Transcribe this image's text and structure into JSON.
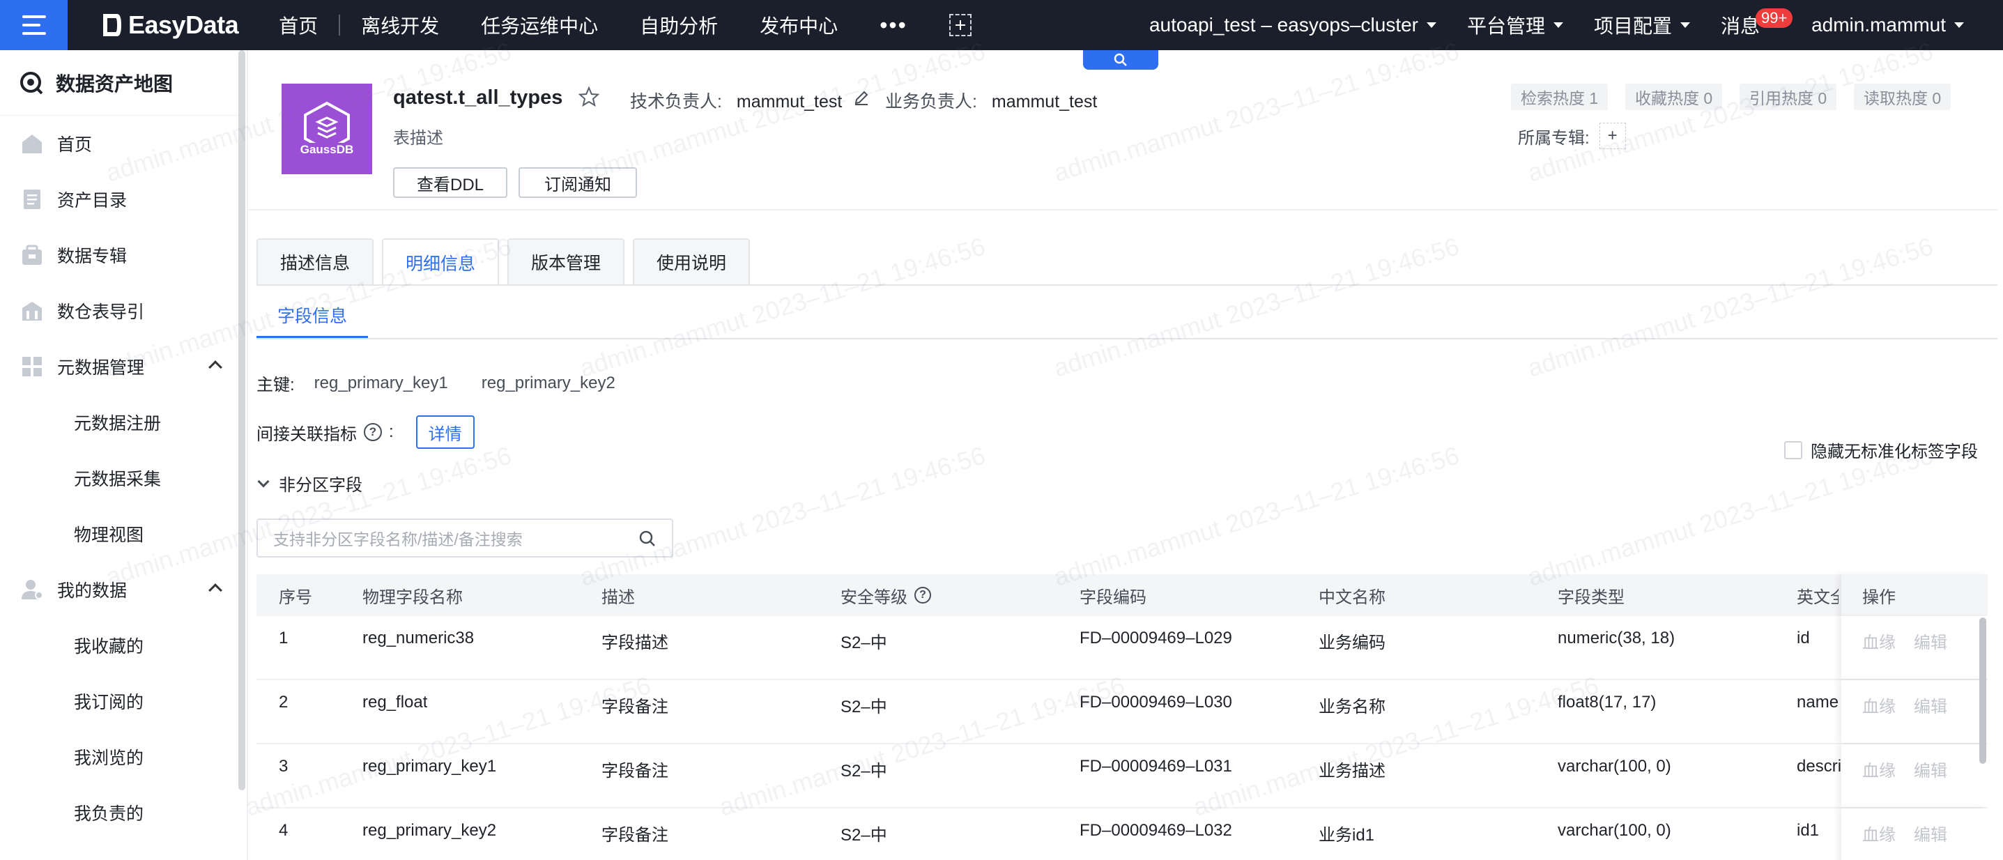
{
  "topnav": {
    "logo": "EasyData",
    "items": [
      "首页",
      "离线开发",
      "任务运维中心",
      "自助分析",
      "发布中心"
    ],
    "more": "•••",
    "cluster": "autoapi_test – easyops–cluster",
    "platform": "平台管理",
    "project": "项目配置",
    "messages": "消息",
    "messages_badge": "99+",
    "user": "admin.mammut"
  },
  "sidebar": {
    "title": "数据资产地图",
    "items": [
      {
        "label": "首页",
        "icon": "home-icon"
      },
      {
        "label": "资产目录",
        "icon": "catalog-icon"
      },
      {
        "label": "数据专辑",
        "icon": "album-icon"
      },
      {
        "label": "数仓表导引",
        "icon": "warehouse-icon"
      },
      {
        "label": "元数据管理",
        "icon": "grid-icon"
      },
      {
        "label": "元数据注册"
      },
      {
        "label": "元数据采集"
      },
      {
        "label": "物理视图"
      },
      {
        "label": "我的数据",
        "icon": "user-icon"
      },
      {
        "label": "我收藏的"
      },
      {
        "label": "我订阅的"
      },
      {
        "label": "我浏览的"
      },
      {
        "label": "我负责的"
      }
    ]
  },
  "header": {
    "db_logo_text": "GaussDB",
    "table_name": "qatest.t_all_types",
    "tech_owner_label": "技术负责人:",
    "tech_owner": "mammut_test",
    "biz_owner_label": "业务负责人:",
    "biz_owner": "mammut_test",
    "description": "表描述",
    "btn_ddl": "查看DDL",
    "btn_subscribe": "订阅通知",
    "heat": [
      "检索热度 1",
      "收藏热度 0",
      "引用热度 0",
      "读取热度 0"
    ],
    "album_label": "所属专辑:",
    "album_add": "+"
  },
  "tabs": [
    "描述信息",
    "明细信息",
    "版本管理",
    "使用说明"
  ],
  "active_tab": "明细信息",
  "subtab": "字段信息",
  "primary_key": {
    "label": "主键:",
    "values": [
      "reg_primary_key1",
      "reg_primary_key2"
    ]
  },
  "indirect": {
    "label": "间接关联指标",
    "colon": ":",
    "detail_btn": "详情"
  },
  "hide_std_label": "隐藏无标准化标签字段",
  "non_partition_label": "非分区字段",
  "search": {
    "placeholder": "支持非分区字段名称/描述/备注搜索"
  },
  "table": {
    "columns": [
      "序号",
      "物理字段名称",
      "描述",
      "安全等级",
      "字段编码",
      "中文名称",
      "字段类型",
      "英文全",
      "操作"
    ],
    "rows": [
      [
        "1",
        "reg_numeric38",
        "字段描述",
        "S2–中",
        "FD–00009469–L029",
        "业务编码",
        "numeric(38, 18)",
        "id"
      ],
      [
        "2",
        "reg_float",
        "字段备注",
        "S2–中",
        "FD–00009469–L030",
        "业务名称",
        "float8(17, 17)",
        "name"
      ],
      [
        "3",
        "reg_primary_key1",
        "字段备注",
        "S2–中",
        "FD–00009469–L031",
        "业务描述",
        "varchar(100, 0)",
        "descri"
      ],
      [
        "4",
        "reg_primary_key2",
        "字段备注",
        "S2–中",
        "FD–00009469–L032",
        "业务id1",
        "varchar(100, 0)",
        "id1"
      ]
    ],
    "ops": [
      "血缘",
      "编辑"
    ]
  },
  "watermark": "admin.mammut 2023–11–21 19:46:56",
  "colors": {
    "accent": "#2d6ff0",
    "nav_bg": "#1b1f2b",
    "badge": "#f03c3c",
    "db_logo": "#9b4fd6"
  }
}
